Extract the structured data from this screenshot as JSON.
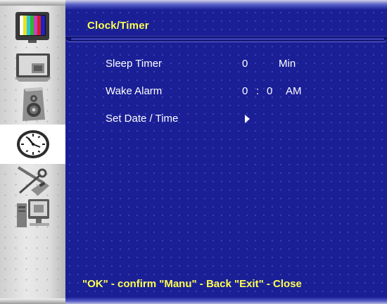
{
  "menu": {
    "title": "Clock/Timer",
    "footer": "\"OK\" - confirm \"Manu\" - Back \"Exit\" - Close",
    "items": [
      {
        "label": "Sleep Timer",
        "value": "0",
        "unit": "Min"
      },
      {
        "label": "Wake Alarm",
        "hour": "0",
        "separator": ":",
        "minute": "0",
        "ampm": "AM"
      },
      {
        "label": "Set Date / Time",
        "arrow": "right-triangle-icon"
      }
    ]
  },
  "sidebar": {
    "items": [
      {
        "icon": "tv-color-bars-icon"
      },
      {
        "icon": "monitor-screen-icon"
      },
      {
        "icon": "speaker-icon"
      },
      {
        "icon": "clock-icon",
        "active": true
      },
      {
        "icon": "tools-icon"
      },
      {
        "icon": "computer-source-icon"
      }
    ]
  },
  "colors": {
    "panel_bg": "#1a1f96",
    "title": "#ffff50",
    "text": "#ffffff",
    "sidebar_bg": "#dcdcdc"
  }
}
